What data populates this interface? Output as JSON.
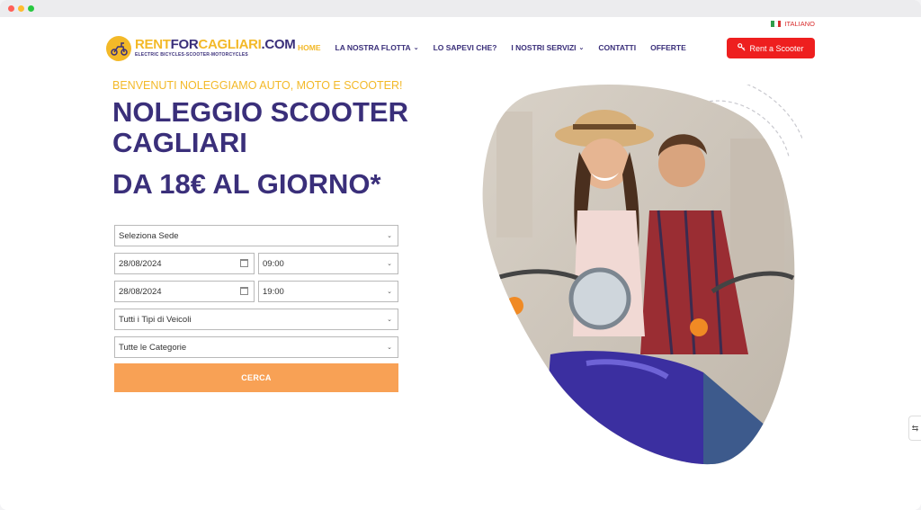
{
  "language": {
    "label": "ITALIANO"
  },
  "logo": {
    "part1": "RENT",
    "part2": "FOR",
    "part3": "CAGLIARI",
    "part4": ".COM",
    "tagline": "ELECTRIC BICYCLES-SCOOTER-MOTORCYCLES"
  },
  "nav": {
    "items": [
      {
        "label": "HOME"
      },
      {
        "label": "LA NOSTRA FLOTTA"
      },
      {
        "label": "LO SAPEVI CHE?"
      },
      {
        "label": "I NOSTRI SERVIZI"
      },
      {
        "label": "CONTATTI"
      },
      {
        "label": "OFFERTE"
      }
    ]
  },
  "cta": {
    "label": "Rent a Scooter"
  },
  "hero": {
    "welcome": "BENVENUTI NOLEGGIAMO AUTO, MOTO E SCOOTER!",
    "title": "NOLEGGIO SCOOTER CAGLIARI",
    "price": "DA 18€ AL GIORNO*"
  },
  "form": {
    "location": "Seleziona Sede",
    "pickup_date": "28/08/2024",
    "pickup_time": "09:00",
    "return_date": "28/08/2024",
    "return_time": "19:00",
    "vehicle_type": "Tutti i Tipi di Veicoli",
    "category": "Tutte le Categorie",
    "search_label": "CERCA"
  },
  "colors": {
    "brand_blue": "#3a2f7a",
    "brand_yellow": "#f3b928",
    "cta_red": "#ee1f1f",
    "search_orange": "#f8a155"
  }
}
